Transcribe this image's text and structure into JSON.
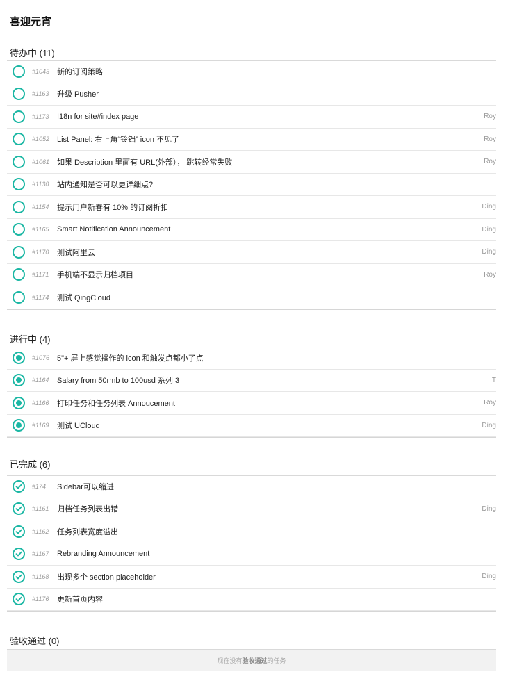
{
  "page": {
    "title": "喜迎元宵"
  },
  "colors": {
    "accent": "#1bb7a4"
  },
  "sections": {
    "todo": {
      "title": "待办中 (11)",
      "status_icon": "empty-circle-icon",
      "tasks": [
        {
          "id": "#1043",
          "title": "新的订阅策略",
          "assignee": ""
        },
        {
          "id": "#1163",
          "title": "升级 Pusher",
          "assignee": ""
        },
        {
          "id": "#1173",
          "title": "I18n for site#index page",
          "assignee": "Roy"
        },
        {
          "id": "#1052",
          "title": "List Panel: 右上角“铃铛” icon 不见了",
          "assignee": "Roy"
        },
        {
          "id": "#1061",
          "title": "如果 Description 里面有 URL(外部）， 跳转经常失败",
          "assignee": "Roy"
        },
        {
          "id": "#1130",
          "title": "站内通知是否可以更详细点?",
          "assignee": ""
        },
        {
          "id": "#1154",
          "title": "提示用户新春有 10% 的订阅折扣",
          "assignee": "Ding"
        },
        {
          "id": "#1165",
          "title": "Smart Notification Announcement",
          "assignee": "Ding"
        },
        {
          "id": "#1170",
          "title": "测试阿里云",
          "assignee": "Ding"
        },
        {
          "id": "#1171",
          "title": "手机端不显示归档项目",
          "assignee": "Roy"
        },
        {
          "id": "#1174",
          "title": "测试 QingCloud",
          "assignee": ""
        }
      ]
    },
    "in_progress": {
      "title": "进行中 (4)",
      "status_icon": "in-progress-circle-icon",
      "tasks": [
        {
          "id": "#1076",
          "title": "5\"+ 屏上感觉操作的 icon 和触发点都小了点",
          "assignee": ""
        },
        {
          "id": "#1164",
          "title": "Salary from 50rmb to 100usd 系列 3",
          "assignee": "T"
        },
        {
          "id": "#1166",
          "title": "打印任务和任务列表 Annoucement",
          "assignee": "Roy"
        },
        {
          "id": "#1169",
          "title": "测试 UCloud",
          "assignee": "Ding"
        }
      ]
    },
    "done": {
      "title": "已完成 (6)",
      "status_icon": "check-circle-icon",
      "tasks": [
        {
          "id": "#174",
          "title": "Sidebar可以缩进",
          "assignee": ""
        },
        {
          "id": "#1161",
          "title": "归档任务列表出错",
          "assignee": "Ding"
        },
        {
          "id": "#1162",
          "title": "任务列表宽度溢出",
          "assignee": ""
        },
        {
          "id": "#1167",
          "title": "Rebranding Announcement",
          "assignee": ""
        },
        {
          "id": "#1168",
          "title": "出现多个 section placeholder",
          "assignee": "Ding"
        },
        {
          "id": "#1176",
          "title": "更新首页内容",
          "assignee": ""
        }
      ]
    },
    "accepted": {
      "title": "验收通过 (0)",
      "empty_prefix": "现在没有",
      "empty_bold": "验收通过",
      "empty_suffix": "的任务"
    }
  }
}
